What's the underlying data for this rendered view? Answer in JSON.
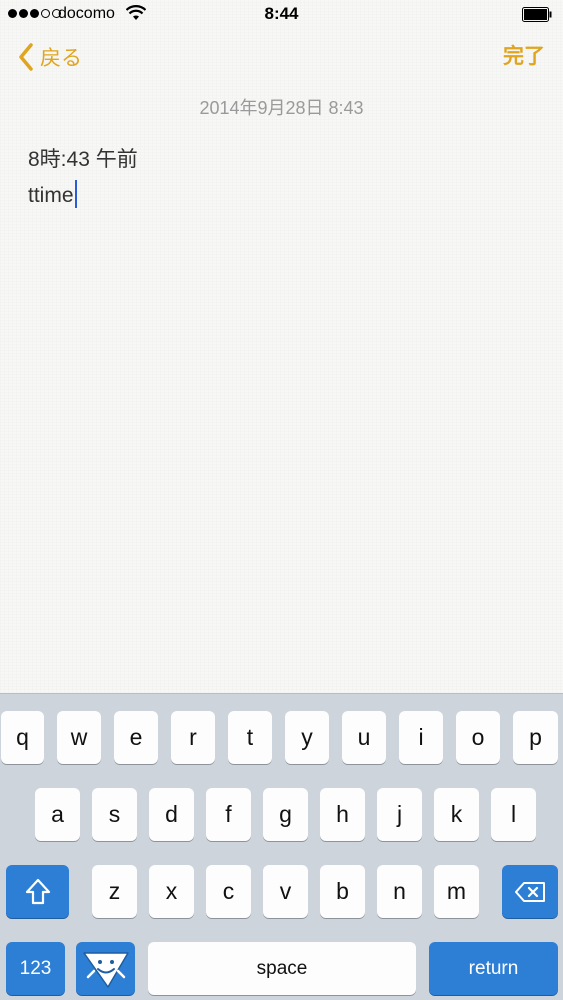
{
  "status_bar": {
    "carrier": "docomo",
    "time": "8:44",
    "signal_bars_filled": 3,
    "signal_bars_total": 5
  },
  "nav": {
    "back_label": "戻る",
    "done_label": "完了",
    "accent_color": "#e0a520"
  },
  "note": {
    "date": "2014年9月28日 8:43",
    "lines": [
      "8時:43 午前",
      "ttime"
    ]
  },
  "keyboard": {
    "row1": [
      "q",
      "w",
      "e",
      "r",
      "t",
      "y",
      "u",
      "i",
      "o",
      "p"
    ],
    "row2": [
      "a",
      "s",
      "d",
      "f",
      "g",
      "h",
      "j",
      "k",
      "l"
    ],
    "row3": [
      "z",
      "x",
      "c",
      "v",
      "b",
      "n",
      "m"
    ],
    "numbers_label": "123",
    "space_label": "space",
    "return_label": "return",
    "blue_color": "#2d7fd6"
  }
}
